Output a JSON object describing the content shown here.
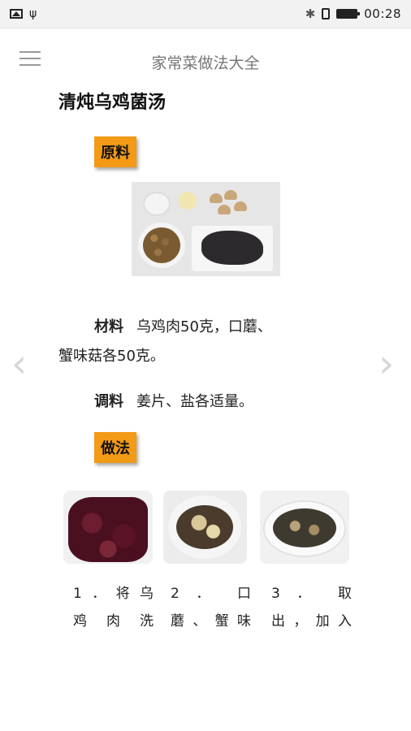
{
  "status_bar": {
    "time": "00:28",
    "icons": [
      "image-icon",
      "usb-icon",
      "bluetooth-icon",
      "sim-icon",
      "battery-icon"
    ]
  },
  "header": {
    "title": "家常菜做法大全",
    "menu_icon": "hamburger-menu-icon"
  },
  "recipe": {
    "title": "清炖乌鸡菌汤",
    "ingredients_tag": "原料",
    "materials_label": "材料",
    "materials_line1": "乌鸡肉50克，口蘑、",
    "materials_line2": "蟹味菇各50克。",
    "seasoning_label": "调料",
    "seasoning_text": "姜片、盐各适量。",
    "method_tag": "做法",
    "steps": [
      {
        "line1": "1．将乌",
        "line2": "鸡 肉 洗"
      },
      {
        "line1": "2 ． 口",
        "line2": "蘑、蟹味"
      },
      {
        "line1": "3 ． 取",
        "line2": "出，加入"
      }
    ]
  },
  "navigation": {
    "prev": "‹",
    "next": "›"
  },
  "colors": {
    "tag_bg": "#f39a16",
    "status_bar_bg": "#f2f2f2"
  }
}
